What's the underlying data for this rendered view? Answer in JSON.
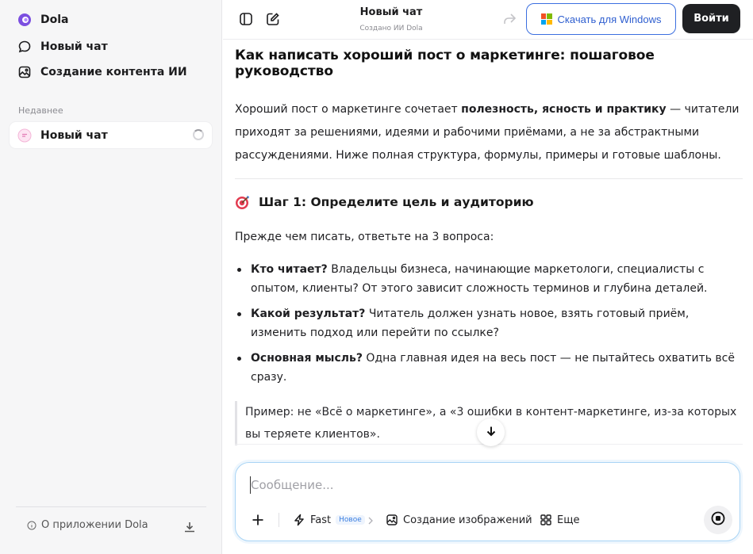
{
  "sidebar": {
    "brand": "Dola",
    "new_chat": "Новый чат",
    "ai_content": "Создание контента ИИ",
    "section_recent": "Недавнее",
    "recent_items": [
      {
        "label": "Новый чат"
      }
    ],
    "about": "О приложении Dola"
  },
  "topbar": {
    "title": "Новый чат",
    "subtitle": "Создано ИИ Dola",
    "download_windows": "Скачать для Windows",
    "login": "Войти"
  },
  "article": {
    "title": "Как написать хороший пост о маркетинге: пошаговое руководство",
    "intro_before": "Хороший пост о маркетинге сочетает ",
    "intro_bold": "полезность, ясность и практику",
    "intro_after": " — читатели приходят за решениями, идеями и рабочими приёмами, а не за абстрактными рассуждениями. Ниже полная структура, формулы, примеры и готовые шаблоны.",
    "step1_title": "Шаг 1: Определите цель и аудиторию",
    "step1_lead": "Прежде чем писать, ответьте на 3 вопроса:",
    "bullets": [
      {
        "bold": "Кто читает?",
        "text": " Владельцы бизнеса, начинающие маркетологи, специалисты с опытом, клиенты? От этого зависит сложность терминов и глубина деталей."
      },
      {
        "bold": "Какой результат?",
        "text": " Читатель должен узнать новое, взять готовый приём, изменить подход или перейти по ссылке?"
      },
      {
        "bold": "Основная мысль?",
        "text": " Одна главная идея на весь пост — не пытайтесь охватить всё сразу."
      }
    ],
    "quote": "Пример: не «Всё о маркетинге», а «3 ошибки в контент-маркетинге, из-за которых вы теряете клиентов»."
  },
  "composer": {
    "placeholder": "Сообщение...",
    "fast_label": "Fast",
    "fast_badge": "Новое",
    "image_gen": "Создание изображений",
    "more": "Еще"
  },
  "colors": {
    "accent_blue": "#3b6fe0",
    "login_bg": "#1f2023",
    "sidebar_bg": "#f6f6f7",
    "composer_border": "#a8d4f5"
  }
}
